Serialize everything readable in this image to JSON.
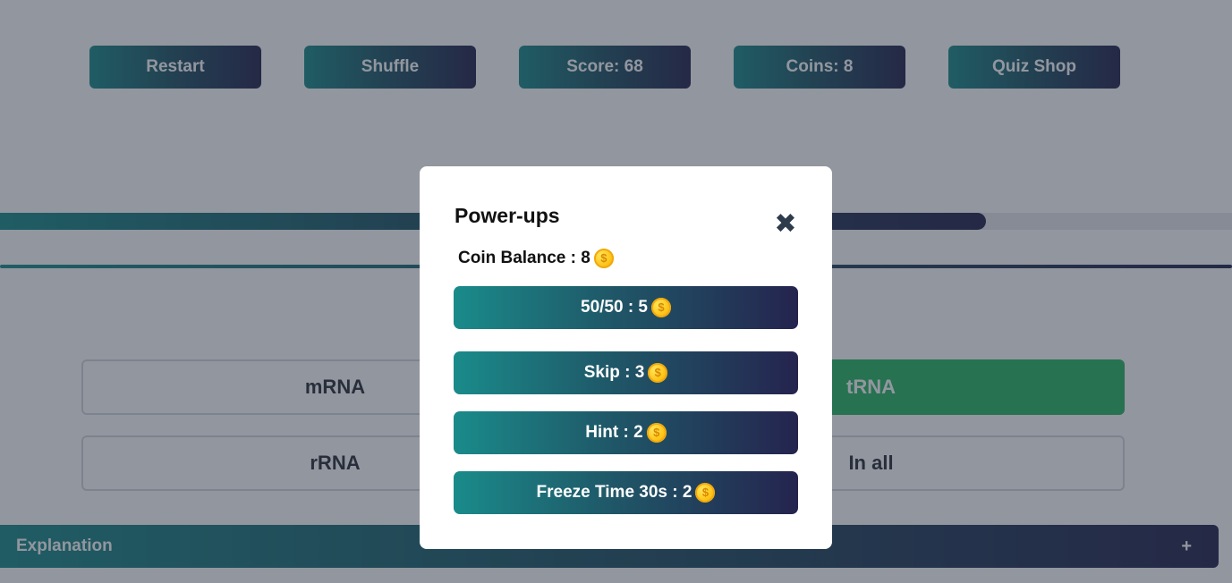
{
  "toolbar": {
    "restart_label": "Restart",
    "shuffle_label": "Shuffle",
    "score_label": "Score: 68",
    "coins_label": "Coins: 8",
    "quiz_shop_label": "Quiz Shop"
  },
  "progress": {
    "fraction": 0.8
  },
  "options": [
    {
      "label": "mRNA",
      "state": "default"
    },
    {
      "label": "tRNA",
      "state": "correct"
    },
    {
      "label": "rRNA",
      "state": "default"
    },
    {
      "label": "In all",
      "state": "default"
    }
  ],
  "explanation": {
    "label": "Explanation",
    "toggle": "+"
  },
  "modal": {
    "title": "Power-ups",
    "close_glyph": "✖",
    "balance_label": "Coin Balance : 8",
    "power_ups": [
      {
        "label": "50/50 : 5"
      },
      {
        "label": "Skip : 3"
      },
      {
        "label": "Hint : 2"
      },
      {
        "label": "Freeze Time 30s : 2"
      }
    ]
  },
  "icons": {
    "coin": "coin-icon",
    "close": "close-icon"
  },
  "colors": {
    "gradient_start": "#1a8b8a",
    "gradient_end": "#25244f",
    "correct": "#28b765",
    "overlay": "rgba(38,46,62,0.5)"
  }
}
